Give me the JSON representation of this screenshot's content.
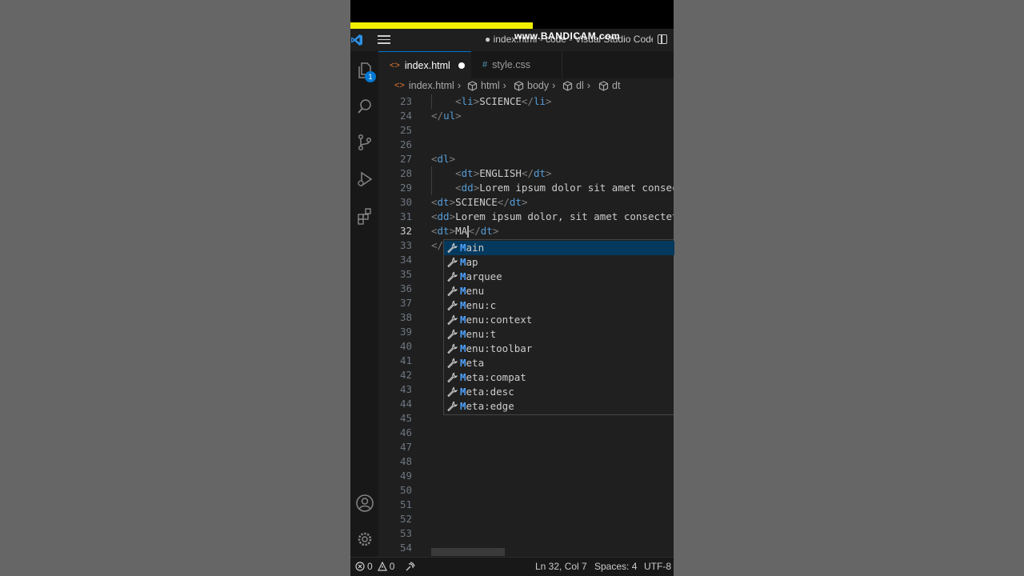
{
  "window": {
    "title": "● index.html - code - Visual Studio Code",
    "watermark": "www.BANDICAM.com"
  },
  "activity_bar": {
    "icons": [
      "files-icon",
      "search-icon",
      "source-control-icon",
      "run-debug-icon",
      "extensions-icon",
      "account-icon",
      "settings-gear-icon"
    ],
    "explorer_badge": "1"
  },
  "tabs": [
    {
      "label": "index.html",
      "icon": "html-icon",
      "modified": true,
      "active": true
    },
    {
      "label": "style.css",
      "icon": "css-icon",
      "modified": false,
      "active": false
    }
  ],
  "breadcrumb": {
    "items": [
      "index.html",
      "html",
      "body",
      "dl",
      "dt"
    ]
  },
  "editor": {
    "lines": [
      {
        "num": "23",
        "text": "    <li>SCIENCE</li>"
      },
      {
        "num": "24",
        "text": "</ul>"
      },
      {
        "num": "25",
        "text": ""
      },
      {
        "num": "26",
        "text": ""
      },
      {
        "num": "27",
        "text": "<dl>"
      },
      {
        "num": "28",
        "text": "    <dt>ENGLISH</dt>"
      },
      {
        "num": "29",
        "text": "    <dd>Lorem ipsum dolor sit amet consect"
      },
      {
        "num": "30",
        "text": "<dt>SCIENCE</dt>"
      },
      {
        "num": "31",
        "text": "<dd>Lorem ipsum dolor, sit amet consectetu"
      },
      {
        "num": "32",
        "text": "<dt>MA</dt>"
      },
      {
        "num": "33",
        "text": "</"
      },
      {
        "num": "34",
        "text": ""
      },
      {
        "num": "35",
        "text": ""
      },
      {
        "num": "36",
        "text": ""
      },
      {
        "num": "37",
        "text": ""
      },
      {
        "num": "38",
        "text": ""
      },
      {
        "num": "39",
        "text": ""
      },
      {
        "num": "40",
        "text": ""
      },
      {
        "num": "41",
        "text": ""
      },
      {
        "num": "42",
        "text": ""
      },
      {
        "num": "43",
        "text": ""
      },
      {
        "num": "44",
        "text": ""
      },
      {
        "num": "45",
        "text": ""
      },
      {
        "num": "46",
        "text": ""
      },
      {
        "num": "47",
        "text": ""
      },
      {
        "num": "48",
        "text": ""
      },
      {
        "num": "49",
        "text": ""
      },
      {
        "num": "50",
        "text": ""
      },
      {
        "num": "51",
        "text": ""
      },
      {
        "num": "52",
        "text": ""
      },
      {
        "num": "53",
        "text": ""
      },
      {
        "num": "54",
        "text": ""
      }
    ],
    "current_line": "32"
  },
  "suggestions": {
    "match_prefix": "M",
    "items": [
      "Main",
      "Map",
      "Marquee",
      "Menu",
      "Menu:c",
      "Menu:context",
      "Menu:t",
      "Menu:toolbar",
      "Meta",
      "Meta:compat",
      "Meta:desc",
      "Meta:edge"
    ],
    "selected_index": 0,
    "icon": "wrench-icon"
  },
  "status_bar": {
    "errors": "0",
    "warnings": "0",
    "position": "Ln 32, Col 7",
    "spaces": "Spaces: 4",
    "encoding": "UTF-8"
  },
  "colors": {
    "accent": "#0078d4",
    "tag_name": "#569cd6",
    "bracket": "#808080",
    "recording_bar": "#f0f000"
  }
}
